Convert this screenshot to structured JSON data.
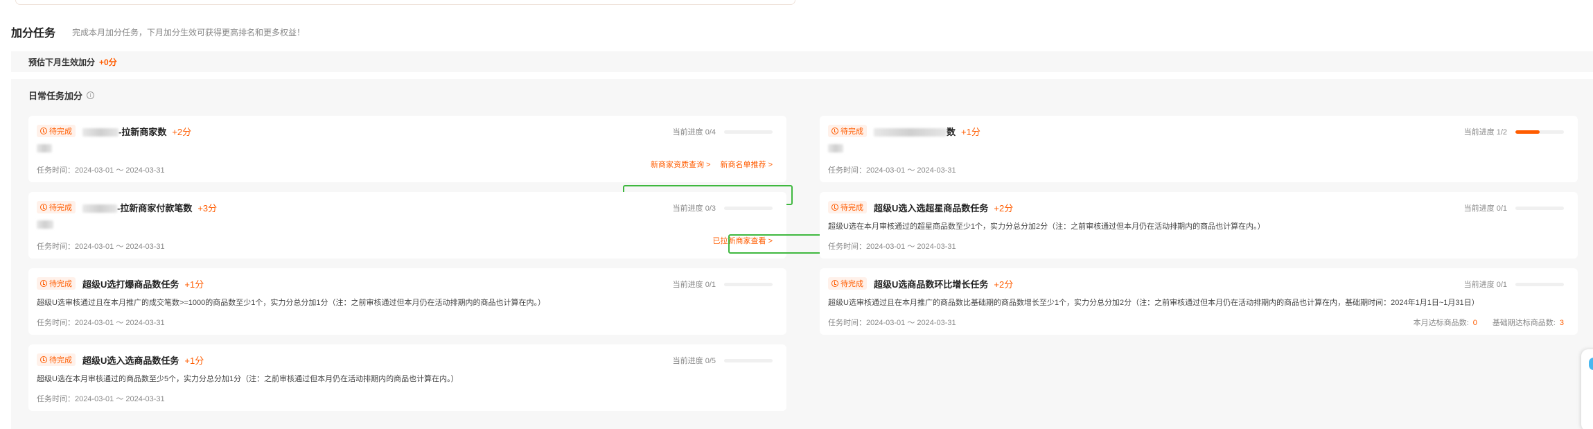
{
  "header": {
    "title": "加分任务",
    "subtitle": "完成本月加分任务，下月加分生效可获得更高排名和更多权益！"
  },
  "estimate": {
    "label": "预估下月生效加分",
    "value": "+0分"
  },
  "daily": {
    "title": "日常任务加分",
    "info_icon": "i"
  },
  "tasks": [
    {
      "status": "待完成",
      "name": "-拉新商家数",
      "score": "+2分",
      "progress_label": "当前进度 0/4",
      "progress": 0.0,
      "desc": "",
      "time": "任务时间：2024-03-01 ～ 2024-03-31",
      "links": [
        "新商家资质查询 >",
        "新商名单推荐 >"
      ]
    },
    {
      "status": "待完成",
      "name": "数",
      "score": "+1分",
      "progress_label": "当前进度 1/2",
      "progress": 0.5,
      "desc": "",
      "time": "任务时间：2024-03-01 ～ 2024-03-31"
    },
    {
      "status": "待完成",
      "name": "-拉新商家付款笔数",
      "score": "+3分",
      "progress_label": "当前进度 0/3",
      "progress": 0.0,
      "desc": "",
      "time": "任务时间：2024-03-01 ～ 2024-03-31",
      "links": [
        "已拉新商家查看 >"
      ]
    },
    {
      "status": "待完成",
      "name": "超级U选入选超星商品数任务",
      "score": "+2分",
      "progress_label": "当前进度 0/1",
      "progress": 0.0,
      "desc": "超级U选在本月审核通过的超星商品数至少1个，实力分总分加2分（注：之前审核通过但本月仍在活动排期内的商品也计算在内。）",
      "time": "任务时间：2024-03-01 ～ 2024-03-31"
    },
    {
      "status": "待完成",
      "name": "超级U选打爆商品数任务",
      "score": "+1分",
      "progress_label": "当前进度 0/1",
      "progress": 0.0,
      "desc": "超级U选审核通过且在本月推广的成交笔数>=1000的商品数至少1个，实力分总分加1分（注：之前审核通过但本月仍在活动排期内的商品也计算在内。）",
      "time": "任务时间：2024-03-01 ～ 2024-03-31"
    },
    {
      "status": "待完成",
      "name": "超级U选商品数环比增长任务",
      "score": "+2分",
      "progress_label": "当前进度 0/1",
      "progress": 0.0,
      "desc": "超级U选审核通过且在本月推广的商品数比基础期的商品数增长至少1个，实力分总分加2分（注：之前审核通过但本月仍在活动排期内的商品也计算在内，基础期时间：2024年1月1日~1月31日）",
      "time": "任务时间：2024-03-01 ～ 2024-03-31",
      "stats": [
        {
          "label": "本月达标商品数:",
          "value": "0"
        },
        {
          "label": "基础期达标商品数:",
          "value": "3"
        }
      ]
    },
    {
      "status": "待完成",
      "name": "超级U选入选商品数任务",
      "score": "+1分",
      "progress_label": "当前进度 0/5",
      "progress": 0.0,
      "desc": "超级U选在本月审核通过的商品数至少5个，实力分总分加1分（注：之前审核通过但本月仍在活动排期内的商品也计算在内。）",
      "time": "任务时间：2024-03-01 ～ 2024-03-31"
    }
  ]
}
